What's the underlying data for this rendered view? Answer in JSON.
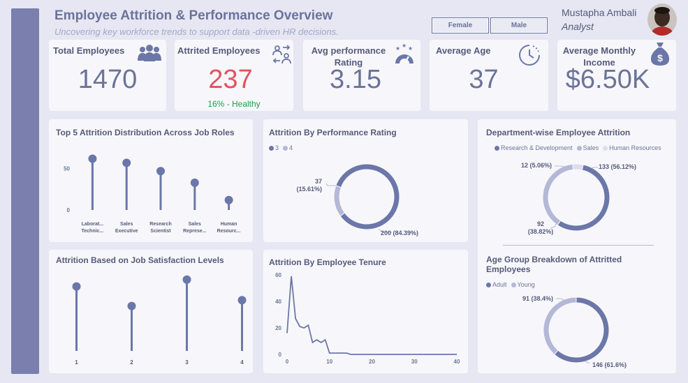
{
  "header": {
    "title": "Employee Attrition & Performance Overview",
    "subtitle": "Uncovering key workforce trends to support data -driven HR decisions.",
    "filters": [
      "Female",
      "Male"
    ],
    "user_name": "Mustapha Ambali",
    "user_role": "Analyst"
  },
  "kpis": {
    "total_label": "Total Employees",
    "total_value": "1470",
    "attrited_label": "Attrited Employees",
    "attrited_value": "237",
    "attrited_sub": "16% - Healthy",
    "rating_label": "Avg performance Rating",
    "rating_value": "3.15",
    "age_label": "Average Age",
    "age_value": "37",
    "income_label": "Average Monthly Income",
    "income_value": "$6.50K"
  },
  "colors": {
    "primary": "#6b77a8",
    "light": "#b4b8d6",
    "lighter": "#dcdeee",
    "positive": "#1f9e4a",
    "negative": "#e0545e"
  },
  "chart_data": [
    {
      "id": "job_roles",
      "type": "lollipop",
      "title": "Top 5 Attrition Distribution Across Job Roles",
      "categories": [
        "Laborat... Technic...",
        "Sales Executive",
        "Research Scientist",
        "Sales Represe...",
        "Human Resourc..."
      ],
      "values": [
        62,
        57,
        47,
        33,
        12
      ],
      "yticks": [
        0,
        50
      ],
      "ylim": [
        0,
        70
      ]
    },
    {
      "id": "perf_rating",
      "type": "pie",
      "title": "Attrition By Performance Rating",
      "legend": [
        "3",
        "4"
      ],
      "values": [
        200,
        37
      ],
      "labels": [
        "200 (84.39%)",
        "37 (15.61%)"
      ]
    },
    {
      "id": "department",
      "type": "pie",
      "title": "Department-wise Employee Attrition",
      "legend": [
        "Research & Development",
        "Sales",
        "Human Resources"
      ],
      "values": [
        133,
        92,
        12
      ],
      "labels": [
        "133 (56.12%)",
        "92 (38.82%)",
        "12 (5.06%)"
      ]
    },
    {
      "id": "job_satisfaction",
      "type": "lollipop",
      "title": "Attrition Based on Job Satisfaction Levels",
      "categories": [
        "1",
        "2",
        "3",
        "4"
      ],
      "values": [
        66,
        46,
        73,
        52
      ],
      "yticks": [
        0,
        20,
        40,
        60,
        80
      ],
      "ylim": [
        0,
        80
      ]
    },
    {
      "id": "tenure",
      "type": "line",
      "title": "Attrition By Employee Tenure",
      "x": [
        0,
        1,
        2,
        3,
        4,
        5,
        6,
        7,
        8,
        9,
        10,
        11,
        12,
        13,
        14,
        15,
        16,
        17,
        18,
        19,
        20,
        21,
        22,
        23,
        24,
        25,
        26,
        27,
        28,
        29,
        30,
        31,
        32,
        33,
        34,
        35,
        36,
        37,
        38,
        39,
        40
      ],
      "values": [
        16,
        59,
        27,
        21,
        20,
        22,
        9,
        11,
        9,
        11,
        1,
        1,
        1,
        1,
        1,
        0,
        0,
        0,
        0,
        0,
        0,
        0,
        0,
        0,
        0,
        0,
        0,
        0,
        0,
        0,
        0,
        0,
        0,
        0,
        0,
        0,
        0,
        0,
        0,
        0,
        0
      ],
      "xticks": [
        0,
        10,
        20,
        30,
        40
      ],
      "yticks": [
        0,
        20,
        40,
        60
      ],
      "xlim": [
        0,
        40
      ],
      "ylim": [
        0,
        60
      ]
    },
    {
      "id": "age_group",
      "type": "pie",
      "title": "Age Group Breakdown of Attritted Employees",
      "legend": [
        "Adult",
        "Young"
      ],
      "values": [
        146,
        91
      ],
      "labels": [
        "146 (61.6%)",
        "91 (38.4%)"
      ]
    }
  ]
}
